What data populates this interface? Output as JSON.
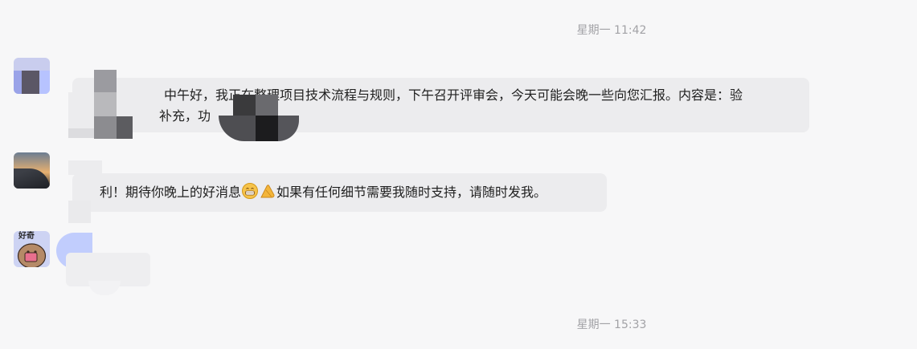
{
  "timestamps": [
    "星期一 11:42",
    "星期一 15:33"
  ],
  "messages": [
    {
      "line1": "中午好，我正在整理项目技术流程与规则，下午召开评审会，今天可能会晚一些向您汇报。内容是：验",
      "line2": "补充，功"
    },
    {
      "text_a": "利！期待你晚上的好消息",
      "text_b": "如果有任何细节需要我随时支持，请随时发我。"
    }
  ],
  "avatar_badge": "好奇",
  "icons": [
    "grin-emoji-icon",
    "thumbs-up-hand-emoji-icon"
  ],
  "colors": {
    "background": "#f7f7f8",
    "bubble": "#ececee",
    "timestamp": "#a2a2a6"
  }
}
